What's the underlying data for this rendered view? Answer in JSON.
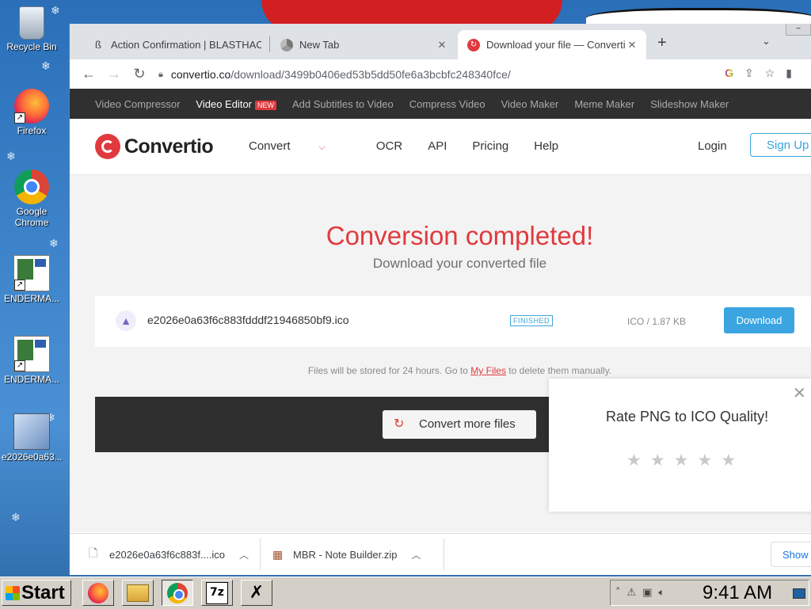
{
  "desktop": {
    "icons": [
      {
        "label": "Recycle Bin"
      },
      {
        "label": "Firefox"
      },
      {
        "label": "Google Chrome"
      },
      {
        "label": "ENDERMA..."
      },
      {
        "label": "ENDERMA..."
      },
      {
        "label": "e2026e0a63..."
      }
    ]
  },
  "browser": {
    "tabs": [
      {
        "title": "Action Confirmation | BLASTHAC",
        "icon": "blasthack-icon",
        "active": false
      },
      {
        "title": "New Tab",
        "icon": "chrome-icon",
        "active": false
      },
      {
        "title": "Download your file — Convertio",
        "icon": "convertio-icon",
        "active": true
      }
    ],
    "url_host": "convertio.co",
    "url_path": "/download/3499b0406ed53b5dd50fe6a3bcbfc248340fce/"
  },
  "page": {
    "topstrip": {
      "items": [
        "Video Compressor",
        "Video Editor",
        "Add Subtitles to Video",
        "Compress Video",
        "Video Maker",
        "Meme Maker",
        "Slideshow Maker"
      ],
      "new_badge": "NEW"
    },
    "brand": "Convertio",
    "nav": {
      "convert": "Convert",
      "ocr": "OCR",
      "api": "API",
      "pricing": "Pricing",
      "help": "Help"
    },
    "login": "Login",
    "signup": "Sign Up",
    "headline": "Conversion completed!",
    "subhead": "Download your converted file",
    "file": {
      "name": "e2026e0a63f6c883fdddf21946850bf9.ico",
      "status": "FINISHED",
      "size": "ICO / 1.87 KB",
      "download_label": "Download"
    },
    "storage_note_before": "Files will be stored for 24 hours. Go to",
    "storage_note_link": "My Files",
    "storage_note_after": "to delete them manually.",
    "convert_more": "Convert more files",
    "rating": {
      "title": "Rate PNG to ICO Quality!",
      "stars": 5,
      "rating": 0
    }
  },
  "downloads": {
    "items": [
      {
        "name": "e2026e0a63f6c883f....ico"
      },
      {
        "name": "MBR - Note Builder.zip"
      }
    ],
    "show_all": "Show a"
  },
  "taskbar": {
    "start": "Start",
    "clock": "9:41 AM"
  },
  "colors": {
    "brand_red": "#e03a3e",
    "accent_blue": "#3aa5e0",
    "dark_bar": "#2f2f2f"
  }
}
